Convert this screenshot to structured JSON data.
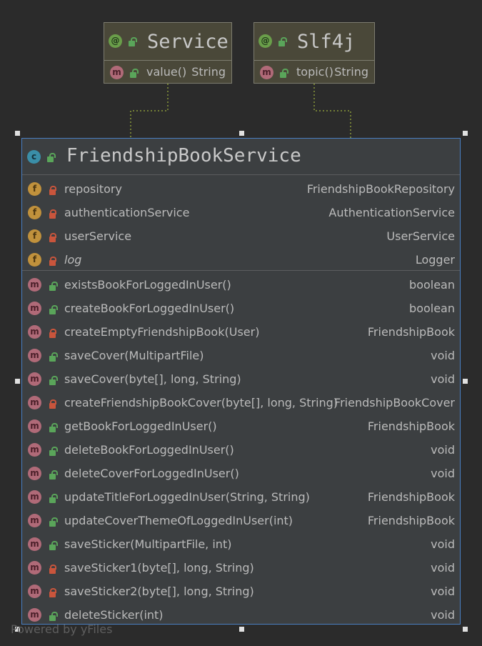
{
  "annotations": [
    {
      "stereotype_icon": "annotation-icon",
      "title": "Service",
      "member": {
        "name": "value()",
        "type": "String"
      }
    },
    {
      "stereotype_icon": "annotation-icon",
      "title": "Slf4j",
      "member": {
        "name": "topic()",
        "type": "String"
      }
    }
  ],
  "class": {
    "kind_icon": "class-icon",
    "title": "FriendshipBookService",
    "fields": [
      {
        "icon": "f",
        "access": "private",
        "name": "repository",
        "type": "FriendshipBookRepository"
      },
      {
        "icon": "f",
        "access": "private",
        "name": "authenticationService",
        "type": "AuthenticationService"
      },
      {
        "icon": "f",
        "access": "private",
        "name": "userService",
        "type": "UserService"
      },
      {
        "icon": "log",
        "access": "private",
        "name": "log",
        "type": "Logger",
        "italic": true
      }
    ],
    "methods": [
      {
        "access": "public",
        "name": "existsBookForLoggedInUser()",
        "type": "boolean"
      },
      {
        "access": "public",
        "name": "createBookForLoggedInUser()",
        "type": "boolean"
      },
      {
        "access": "private",
        "name": "createEmptyFriendshipBook(User)",
        "type": "FriendshipBook"
      },
      {
        "access": "public",
        "name": "saveCover(MultipartFile)",
        "type": "void"
      },
      {
        "access": "public",
        "name": "saveCover(byte[], long, String)",
        "type": "void"
      },
      {
        "access": "private",
        "name": "createFriendshipBookCover(byte[], long, String)",
        "type": "FriendshipBookCover"
      },
      {
        "access": "public",
        "name": "getBookForLoggedInUser()",
        "type": "FriendshipBook"
      },
      {
        "access": "public",
        "name": "deleteBookForLoggedInUser()",
        "type": "void"
      },
      {
        "access": "public",
        "name": "deleteCoverForLoggedInUser()",
        "type": "void"
      },
      {
        "access": "public",
        "name": "updateTitleForLoggedInUser(String, String)",
        "type": "FriendshipBook"
      },
      {
        "access": "public",
        "name": "updateCoverThemeOfLoggedInUser(int)",
        "type": "FriendshipBook"
      },
      {
        "access": "public",
        "name": "saveSticker(MultipartFile, int)",
        "type": "void"
      },
      {
        "access": "private",
        "name": "saveSticker1(byte[], long, String)",
        "type": "void"
      },
      {
        "access": "private",
        "name": "saveSticker2(byte[], long, String)",
        "type": "void"
      },
      {
        "access": "public",
        "name": "deleteSticker(int)",
        "type": "void"
      }
    ]
  },
  "watermark": "Powered by yFiles",
  "colors": {
    "background": "#2b2b2b",
    "class_fill": "#3c3f41",
    "class_border": "#4a7fc1",
    "annotation_fill": "#4a4839",
    "connector": "#8a9a3a"
  }
}
